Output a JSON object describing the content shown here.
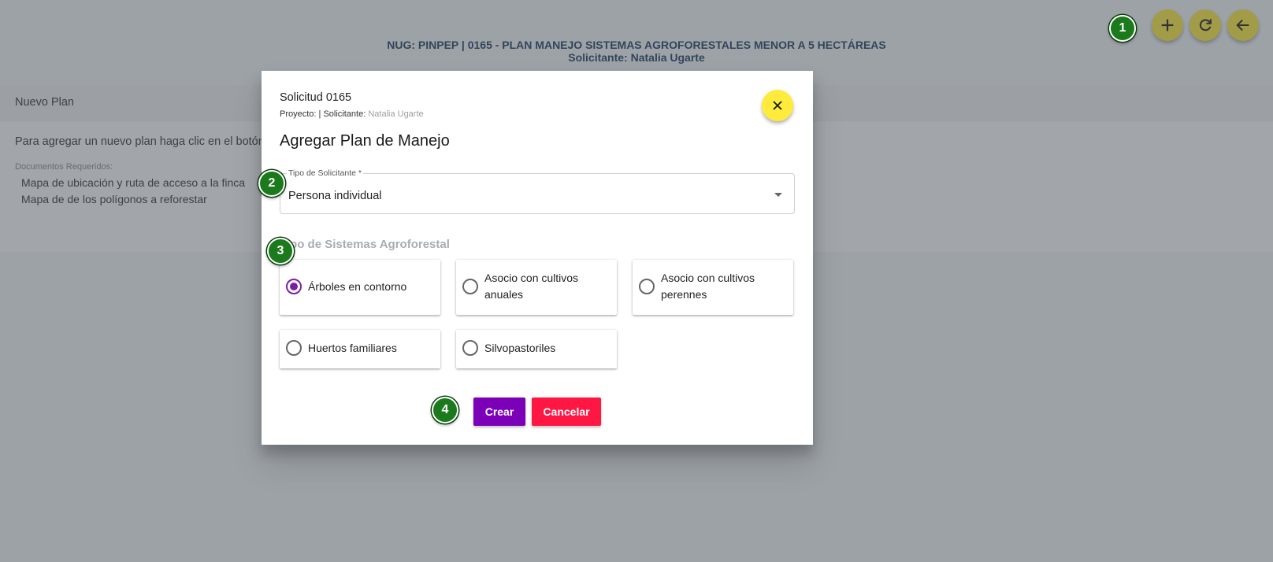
{
  "header": {
    "title": "NUG: PINPEP | 0165 - PLAN MANEJO SISTEMAS AGROFORESTALES MENOR A 5 HECTÁREAS",
    "subtitle": "Solicitante: Natalia Ugarte"
  },
  "toolbar": {
    "add_icon": "plus-icon",
    "refresh_icon": "refresh-icon",
    "back_icon": "arrow-left-icon",
    "button_color": "#ffeb3b"
  },
  "panel": {
    "title": "Nuevo Plan",
    "instruction": "Para agregar un nuevo plan haga clic en el botón",
    "docs_label": "Documentos Requeridos:",
    "docs": [
      "Mapa de ubicación y ruta de acceso a la finca",
      "Mapa de de los polígonos a reforestar"
    ]
  },
  "badges": [
    "1",
    "2",
    "3",
    "4"
  ],
  "dialog": {
    "title": "Solicitud 0165",
    "project_label": "Proyecto:",
    "separator": "|",
    "applicant_label": "Solicitante:",
    "applicant_name": "Natalia Ugarte",
    "heading": "Agregar Plan de Manejo",
    "close_icon": "close-icon",
    "select": {
      "label": "Tipo de Solicitante *",
      "value": "Persona individual"
    },
    "group_label": "Tipo de Sistemas Agroforestal",
    "options": [
      {
        "label": "Árboles en contorno",
        "checked": true
      },
      {
        "label": "Asocio con cultivos anuales",
        "checked": false
      },
      {
        "label": "Asocio con cultivos perennes",
        "checked": false
      },
      {
        "label": "Huertos familiares",
        "checked": false
      },
      {
        "label": "Silvopastoriles",
        "checked": false
      }
    ],
    "create_label": "Crear",
    "cancel_label": "Cancelar",
    "accent_color": "#7b00b8",
    "cancel_color": "#ff1744"
  }
}
